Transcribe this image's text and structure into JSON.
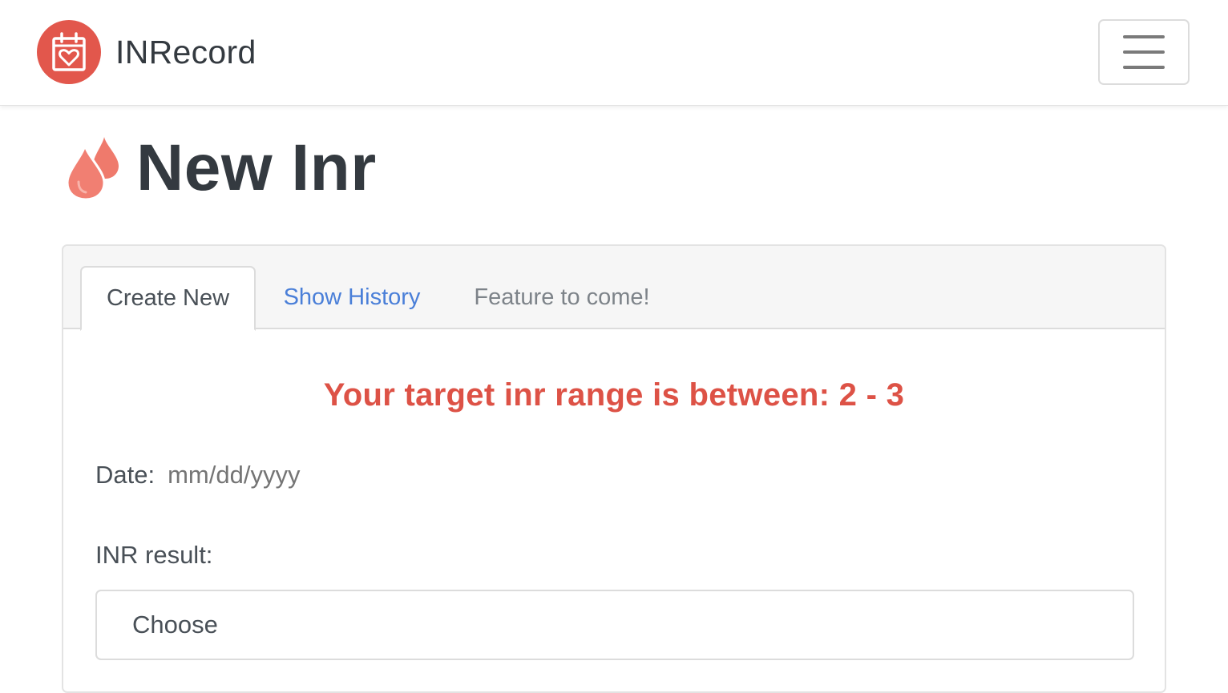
{
  "navbar": {
    "brand_name": "INRecord",
    "logo_icon": "calendar-heart-icon",
    "toggle_icon": "hamburger-menu-icon"
  },
  "page": {
    "title": "New Inr",
    "title_icon": "blood-drops-icon"
  },
  "tabs": [
    {
      "label": "Create New",
      "state": "active"
    },
    {
      "label": "Show History",
      "state": "link"
    },
    {
      "label": "Feature to come!",
      "state": "disabled"
    }
  ],
  "form": {
    "target_message": "Your target inr range is between: 2 - 3",
    "date_label": "Date:",
    "date_placeholder": "mm/dd/yyyy",
    "inr_label": "INR result:",
    "inr_select_value": "Choose"
  },
  "colors": {
    "brand_red": "#e2574c",
    "target_red": "#dd5246",
    "link_blue": "#4a7fd8",
    "drop_red": "#f07a6e"
  }
}
